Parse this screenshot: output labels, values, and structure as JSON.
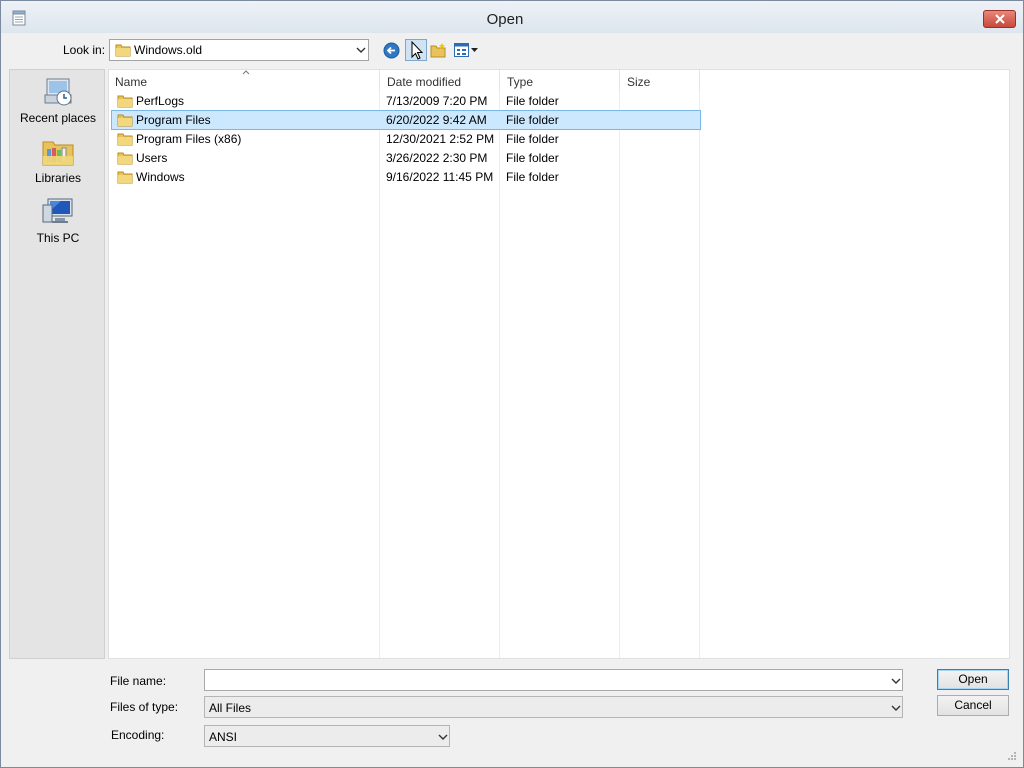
{
  "window": {
    "title": "Open"
  },
  "toolbar": {
    "look_in_label": "Look in:",
    "look_in_value": "Windows.old",
    "icons": [
      "back-icon",
      "up-folder-icon",
      "new-folder-icon",
      "view-menu-icon"
    ]
  },
  "places": [
    {
      "label": "Recent places",
      "icon": "recent-places-icon"
    },
    {
      "label": "Libraries",
      "icon": "libraries-icon"
    },
    {
      "label": "This PC",
      "icon": "this-pc-icon"
    }
  ],
  "file_list": {
    "columns": [
      "Name",
      "Date modified",
      "Type",
      "Size"
    ],
    "rows": [
      {
        "name": "PerfLogs",
        "date": "7/13/2009 7:20 PM",
        "type": "File folder",
        "size": ""
      },
      {
        "name": "Program Files",
        "date": "6/20/2022 9:42 AM",
        "type": "File folder",
        "size": "",
        "selected": true
      },
      {
        "name": "Program Files (x86)",
        "date": "12/30/2021 2:52 PM",
        "type": "File folder",
        "size": ""
      },
      {
        "name": "Users",
        "date": "3/26/2022 2:30 PM",
        "type": "File folder",
        "size": ""
      },
      {
        "name": "Windows",
        "date": "9/16/2022 11:45 PM",
        "type": "File folder",
        "size": ""
      }
    ]
  },
  "form": {
    "file_name_label": "File name:",
    "file_name_value": "",
    "files_of_type_label": "Files of type:",
    "files_of_type_value": "All Files",
    "encoding_label": "Encoding:",
    "encoding_value": "ANSI"
  },
  "buttons": {
    "open": "Open",
    "cancel": "Cancel"
  },
  "colors": {
    "selection": "#cce8ff",
    "close_button": "#c74a3b",
    "folder": "#e8c25a"
  }
}
